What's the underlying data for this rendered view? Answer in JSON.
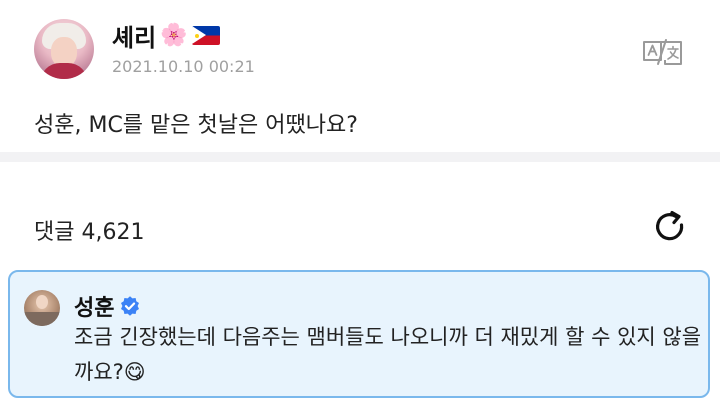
{
  "post": {
    "username": "셰리",
    "username_emoji": "🌸",
    "flag_icon": "philippines-flag-icon",
    "timestamp": "2021.10.10 00:21",
    "body": "성훈, MC를 맡은 첫날은 어땠나요?",
    "translate_icon": "translate-icon"
  },
  "comments": {
    "label": "댓글",
    "count": "4,621",
    "refresh_icon": "refresh-icon"
  },
  "highlighted_comment": {
    "author": "성훈",
    "verified_icon": "verified-badge-icon",
    "text": "조금 긴장했는데 다음주는 맴버들도 나오니까 더 재밌게 할 수 있지 않을까요?",
    "emoji": "😋"
  },
  "colors": {
    "highlight_bg": "#e8f4fd",
    "highlight_border": "#7ab8ec",
    "verified_blue": "#3b82f6",
    "timestamp_gray": "#a0a0a0"
  }
}
